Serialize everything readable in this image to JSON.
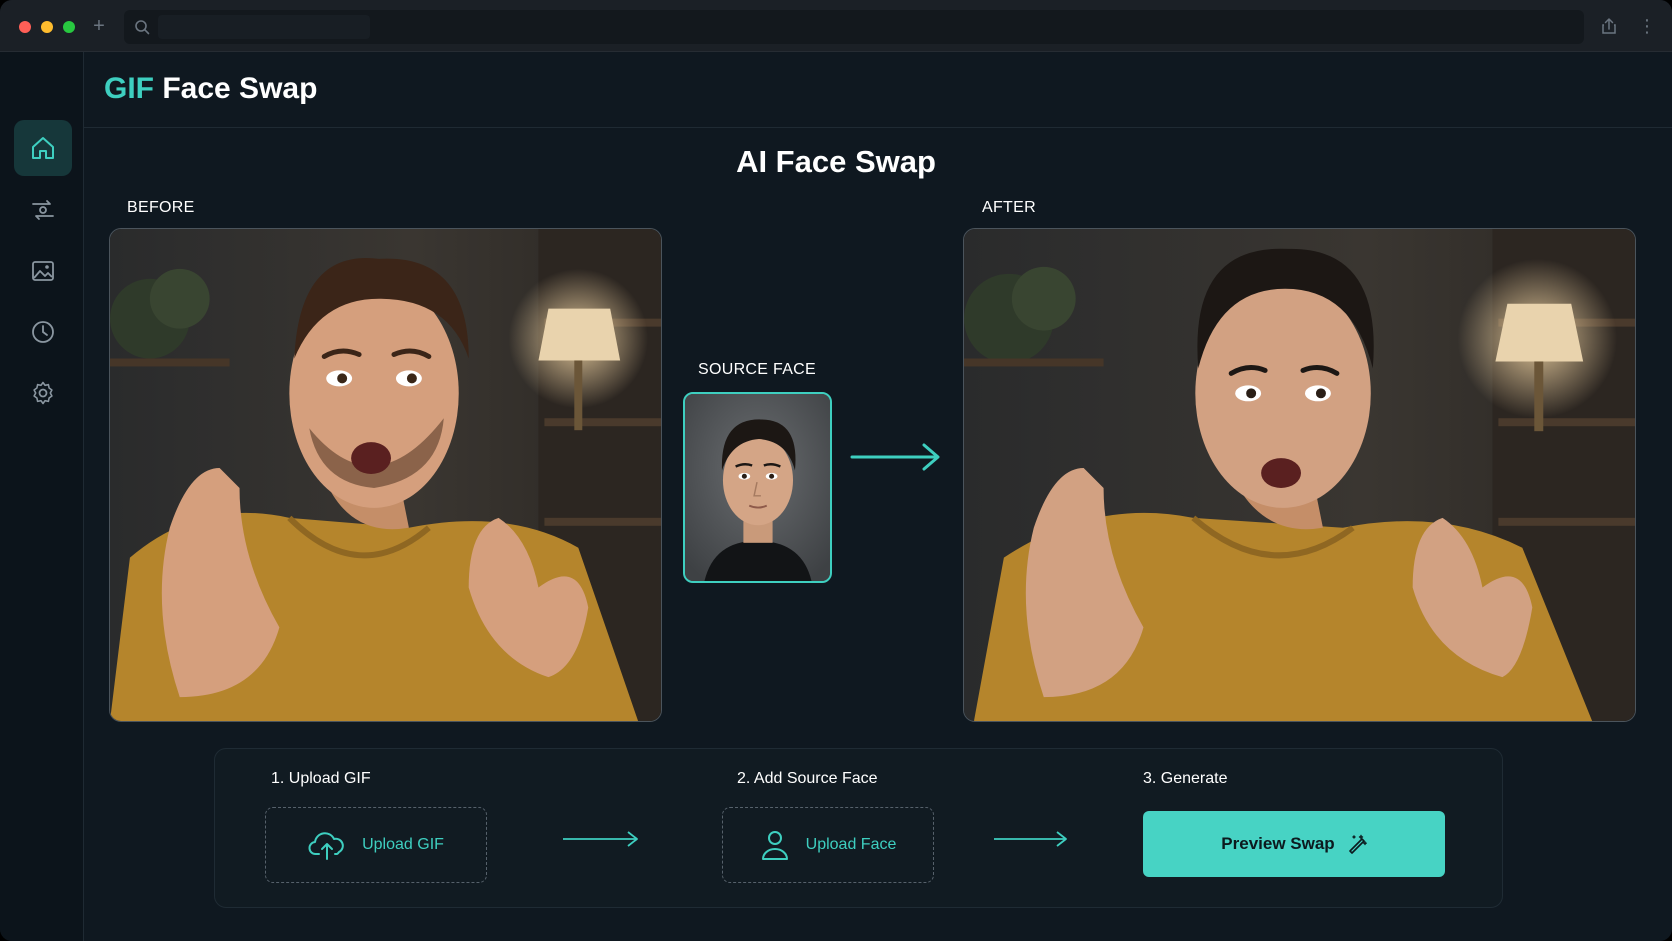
{
  "app": {
    "brand_accent": "GIF",
    "brand_rest": "Face Swap",
    "accent_color": "#3ecfc0"
  },
  "sidebar": {
    "items": [
      {
        "icon": "home-icon",
        "active": true
      },
      {
        "icon": "face-swap-icon",
        "active": false
      },
      {
        "icon": "gallery-icon",
        "active": false
      },
      {
        "icon": "history-icon",
        "active": false
      },
      {
        "icon": "settings-icon",
        "active": false
      }
    ]
  },
  "main": {
    "title": "AI Face Swap",
    "before_label": "BEFORE",
    "after_label": "AFTER",
    "source_label": "SOURCE FACE"
  },
  "steps": {
    "step1_title": "1. Upload GIF",
    "step1_button": "Upload GIF",
    "step2_title": "2. Add Source Face",
    "step2_button": "Upload Face",
    "step3_title": "3. Generate",
    "step3_button": "Preview Swap"
  }
}
